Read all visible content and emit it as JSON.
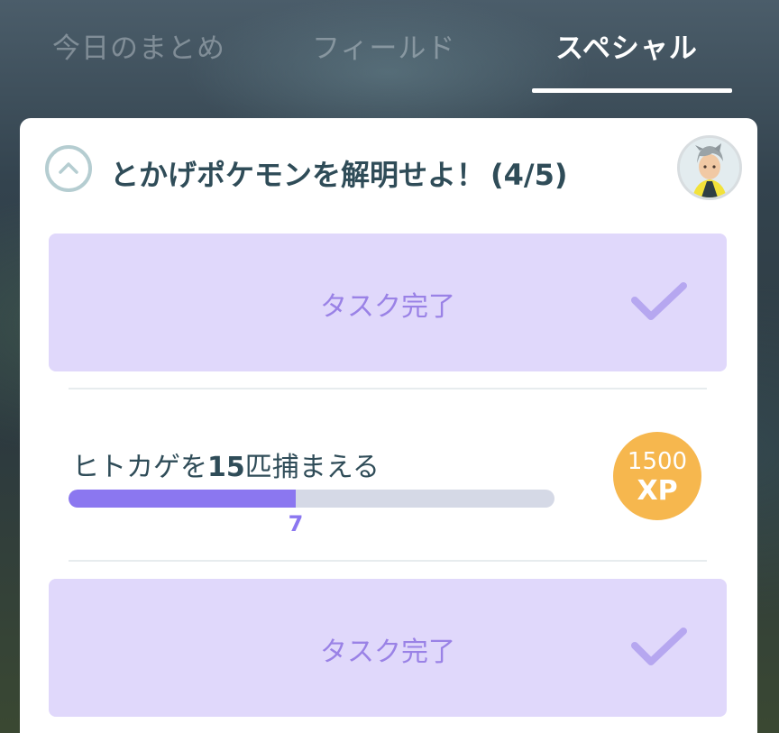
{
  "tabs": {
    "today": "今日のまとめ",
    "field": "フィールド",
    "special": "スペシャル"
  },
  "quest": {
    "title": "とかげポケモンを解明せよ！",
    "progress": "(4/5)",
    "avatar_icon": "professor-avatar"
  },
  "tasks": {
    "done_label_1": "タスク完了",
    "done_label_2": "タスク完了",
    "active": {
      "text_before": "ヒトカゲを",
      "count_target": "15",
      "text_after": "匹捕まえる",
      "current": "7",
      "target": 15,
      "reward_amount": "1500",
      "reward_unit": "XP"
    }
  },
  "colors": {
    "accent": "#8b77f0",
    "done_panel": "#e0d8fb",
    "xp_badge": "#f6b74e",
    "title_text": "#2f4c58"
  }
}
